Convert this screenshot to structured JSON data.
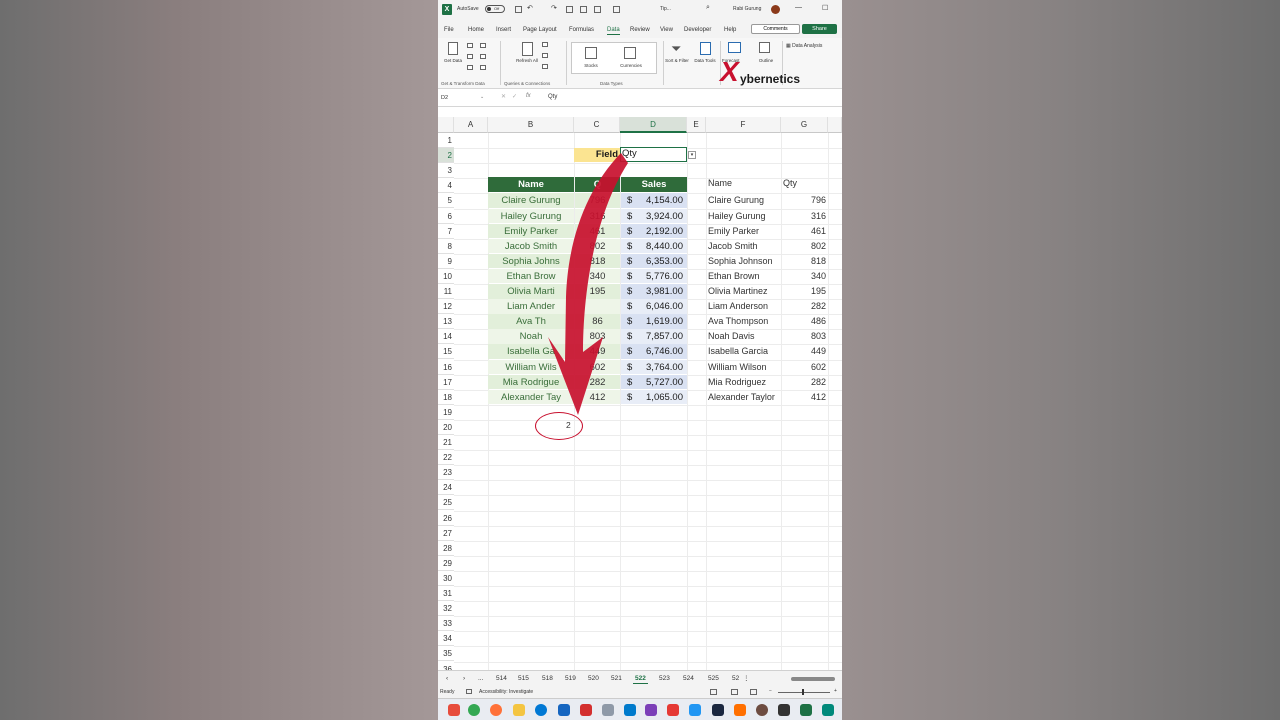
{
  "window": {
    "autosave_label": "AutoSave",
    "autosave_state": "Off",
    "file_name": "Tip...",
    "user_name": "Rabi Gurung"
  },
  "menu": {
    "tabs": [
      "File",
      "Home",
      "Insert",
      "Page Layout",
      "Formulas",
      "Data",
      "Review",
      "View",
      "Developer",
      "Help"
    ],
    "active_tab": "Data",
    "comments_label": "Comments",
    "share_label": "Share"
  },
  "ribbon": {
    "get_data": "Get Data",
    "refresh_all": "Refresh All",
    "stocks": "Stocks",
    "currencies": "Currencies",
    "sort_filter": "Sort & Filter",
    "data_tools": "Data Tools",
    "forecast": "Forecast",
    "outline": "Outline",
    "data_analysis": "Data Analysis",
    "group_get_transform": "Get & Transform Data",
    "group_queries": "Queries & Connections",
    "group_data_types": "Data Types"
  },
  "watermark": {
    "x": "X",
    "text": "ybernetics"
  },
  "formula_bar": {
    "name_box": "D2",
    "fx": "fx",
    "value": "Qty"
  },
  "grid": {
    "columns": [
      "A",
      "B",
      "C",
      "D",
      "E",
      "F",
      "G"
    ],
    "rows": [
      "1",
      "2",
      "3",
      "4",
      "5",
      "6",
      "7",
      "8",
      "9",
      "10",
      "11",
      "12",
      "13",
      "14",
      "15",
      "16",
      "17",
      "18",
      "19",
      "20",
      "21",
      "22",
      "23",
      "24",
      "25",
      "26",
      "27",
      "28",
      "29",
      "30",
      "31",
      "32",
      "33",
      "34",
      "35",
      "36"
    ],
    "selected_column": "D",
    "field_label": "Field",
    "field_value": "Qty",
    "table_headers": {
      "name": "Name",
      "qty": "Q",
      "sales": "Sales"
    },
    "table_rows": [
      {
        "name": "Claire Gurung",
        "qty": "796",
        "sales": "4,154.00"
      },
      {
        "name": "Hailey Gurung",
        "qty": "316",
        "sales": "3,924.00"
      },
      {
        "name": "Emily Parker",
        "qty": "461",
        "sales": "2,192.00"
      },
      {
        "name": "Jacob Smith",
        "qty": "802",
        "sales": "8,440.00"
      },
      {
        "name": "Sophia Johns",
        "qty": "818",
        "sales": "6,353.00"
      },
      {
        "name": "Ethan Brow",
        "qty": "340",
        "sales": "5,776.00"
      },
      {
        "name": "Olivia Marti",
        "qty": "195",
        "sales": "3,981.00"
      },
      {
        "name": "Liam Ander",
        "qty": "",
        "sales": "6,046.00"
      },
      {
        "name": "Ava Th",
        "qty": "86",
        "sales": "1,619.00"
      },
      {
        "name": "Noah",
        "qty": "803",
        "sales": "7,857.00"
      },
      {
        "name": "Isabella Ga",
        "qty": "449",
        "sales": "6,746.00"
      },
      {
        "name": "William Wils",
        "qty": "602",
        "sales": "3,764.00"
      },
      {
        "name": "Mia Rodrigue",
        "qty": "282",
        "sales": "5,727.00"
      },
      {
        "name": "Alexander Tay",
        "qty": "412",
        "sales": "1,065.00"
      }
    ],
    "currency_symbol": "$",
    "right_headers": {
      "name": "Name",
      "qty": "Qty"
    },
    "right_rows": [
      {
        "name": "Claire Gurung",
        "qty": "796"
      },
      {
        "name": "Hailey Gurung",
        "qty": "316"
      },
      {
        "name": "Emily Parker",
        "qty": "461"
      },
      {
        "name": "Jacob Smith",
        "qty": "802"
      },
      {
        "name": "Sophia Johnson",
        "qty": "818"
      },
      {
        "name": "Ethan Brown",
        "qty": "340"
      },
      {
        "name": "Olivia Martinez",
        "qty": "195"
      },
      {
        "name": "Liam Anderson",
        "qty": "282"
      },
      {
        "name": "Ava Thompson",
        "qty": "486"
      },
      {
        "name": "Noah Davis",
        "qty": "803"
      },
      {
        "name": "Isabella Garcia",
        "qty": "449"
      },
      {
        "name": "William Wilson",
        "qty": "602"
      },
      {
        "name": "Mia Rodriguez",
        "qty": "282"
      },
      {
        "name": "Alexander Taylor",
        "qty": "412"
      }
    ],
    "result_value": "2"
  },
  "sheets": {
    "tabs": [
      "...",
      "514",
      "515",
      "518",
      "519",
      "520",
      "521",
      "522",
      "523",
      "524",
      "525",
      "52"
    ],
    "active": "522"
  },
  "status": {
    "ready": "Ready",
    "accessibility": "Accessibility: Investigate"
  },
  "colors": {
    "excel_green": "#1e7145",
    "header_green": "#2f6b3a",
    "name_fill": "#e2efda",
    "sales_fill": "#d9e1f2",
    "field_fill": "#fbe491",
    "arrow_red": "#c8102e"
  }
}
